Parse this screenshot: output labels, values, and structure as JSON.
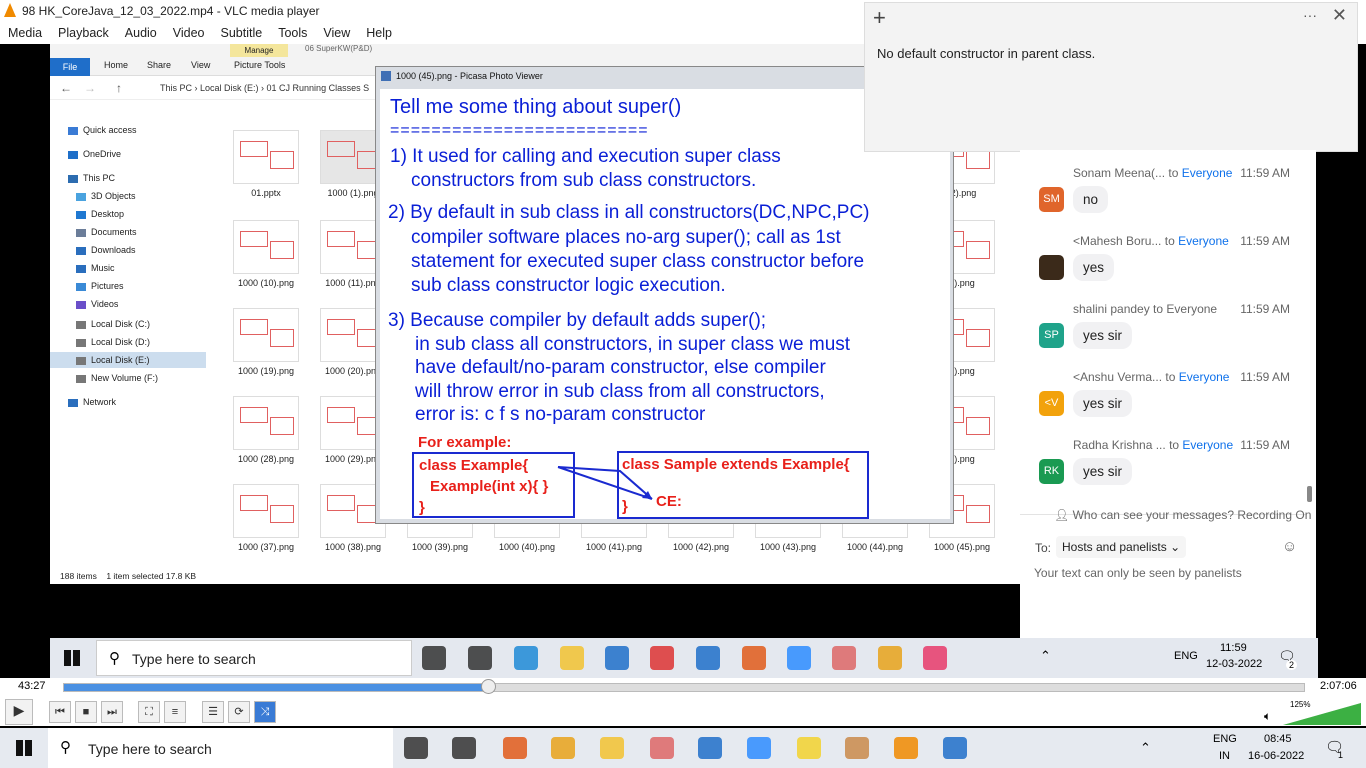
{
  "vlc": {
    "title": "98 HK_CoreJava_12_03_2022.mp4 - VLC media player",
    "menu": [
      "Media",
      "Playback",
      "Audio",
      "Video",
      "Subtitle",
      "Tools",
      "View",
      "Help"
    ],
    "elapsed": "43:27",
    "duration": "2:07:06",
    "progress": 0.343,
    "volume": "125%"
  },
  "explorer": {
    "tabs": [
      "File",
      "Home",
      "Share",
      "View",
      "Picture Tools"
    ],
    "manage": "Manage",
    "context": "06 SuperKW(P&D)",
    "crumbs": [
      "This PC",
      "Local Disk (E:)",
      "01 CJ Running Classes S"
    ],
    "nav": [
      {
        "label": "Quick access",
        "color": "#3a7bd5"
      },
      {
        "label": "OneDrive",
        "color": "#1e6fc9"
      },
      {
        "label": "This PC",
        "color": "#2c6cb0"
      },
      {
        "label": "3D Objects",
        "color": "#4aa3df"
      },
      {
        "label": "Desktop",
        "color": "#1f78d1"
      },
      {
        "label": "Documents",
        "color": "#6b7d99"
      },
      {
        "label": "Downloads",
        "color": "#2a6ebd"
      },
      {
        "label": "Music",
        "color": "#2a6ebd"
      },
      {
        "label": "Pictures",
        "color": "#3a8ad6"
      },
      {
        "label": "Videos",
        "color": "#6a4fc9"
      },
      {
        "label": "Local Disk (C:)",
        "color": "#777"
      },
      {
        "label": "Local Disk (D:)",
        "color": "#777"
      },
      {
        "label": "Local Disk (E:)",
        "color": "#777"
      },
      {
        "label": "New Volume (F:)",
        "color": "#777"
      },
      {
        "label": "Network",
        "color": "#2a6ebd"
      }
    ],
    "files": [
      [
        "01.pptx",
        "1000 (1).png",
        "-2).png"
      ],
      [
        "1000 (10).png",
        "1000 (11).png",
        "8).png"
      ],
      [
        "1000 (19).png",
        "1000 (20).png",
        "7).png"
      ],
      [
        "1000 (28).png",
        "1000 (29).png",
        "6).png"
      ],
      [
        "1000 (37).png",
        "1000 (38).png",
        "1000 (39).png",
        "1000 (40).png",
        "1000 (41).png",
        "1000 (42).png",
        "1000 (43).png",
        "1000 (44).png",
        "1000 (45).png"
      ]
    ],
    "status": [
      "188 items",
      "1 item selected  17.8 KB"
    ]
  },
  "picasa": {
    "title": "1000 (45).png - Picasa Photo Viewer",
    "slide": {
      "heading": "Tell me some thing about super()",
      "rule": "=========================",
      "p1": [
        "1) It used for calling and execution super class",
        "constructors from sub class constructors."
      ],
      "p2": [
        "2) By default in sub class in all constructors(DC,NPC,PC)",
        "compiler software places no-arg super(); call as 1st",
        "statement for executed super class constructor before",
        "sub class constructor logic execution."
      ],
      "p3": [
        "3) Because compiler by default adds super();",
        "in sub class all constructors, in super class we must",
        "have default/no-param constructor, else compiler",
        "will throw error in sub class from all constructors,",
        "error is: c f s no-param constructor"
      ],
      "example_label": "For example:",
      "code_left": [
        "class Example{",
        "Example(int x){  }",
        "}"
      ],
      "code_right": [
        "class Sample extends Example{",
        "}",
        "CE:"
      ]
    }
  },
  "notification": {
    "text": "No default constructor in parent class."
  },
  "chat": {
    "messages": [
      {
        "sender": "Sonam Meena(...",
        "to": "to",
        "audience": "Everyone",
        "time": "11:59 AM",
        "initials": "SM",
        "avatar_color": "#e0652b",
        "text": "no"
      },
      {
        "sender": "<Mahesh Boru...",
        "to": "to",
        "audience": "Everyone",
        "time": "11:59 AM",
        "initials": "",
        "avatar_color": "#3b2a1a",
        "text": "yes"
      },
      {
        "sender": "shalini pandey to Everyone",
        "to": "",
        "audience": "",
        "time": "11:59 AM",
        "initials": "SP",
        "avatar_color": "#1fa38a",
        "text": "yes sir"
      },
      {
        "sender": "<Anshu Verma...",
        "to": "to",
        "audience": "Everyone",
        "time": "11:59 AM",
        "initials": "<V",
        "avatar_color": "#f2a20c",
        "text": "yes sir"
      },
      {
        "sender": "Radha Krishna ...",
        "to": "to",
        "audience": "Everyone",
        "time": "11:59 AM",
        "initials": "RK",
        "avatar_color": "#1a9a52",
        "text": "yes sir"
      }
    ],
    "privacy": "Who can see your messages? Recording On",
    "to_label": "To:",
    "to_value": "Hosts and panelists",
    "placeholder": "Your text can only be seen by panelists"
  },
  "inner_taskbar": {
    "search": "Type here to search",
    "lang": "ENG",
    "time": "11:59",
    "date": "12-03-2022",
    "badge": "2"
  },
  "outer_taskbar": {
    "search": "Type here to search",
    "lang": "ENG",
    "region": "IN",
    "time": "08:45",
    "date": "16-06-2022",
    "badge": "1"
  }
}
